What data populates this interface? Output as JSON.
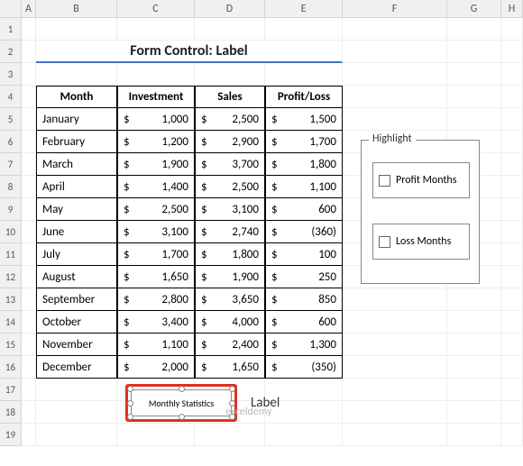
{
  "columns": [
    "A",
    "B",
    "C",
    "D",
    "E",
    "F",
    "G",
    "H"
  ],
  "title": "Form Control: Label",
  "table": {
    "headers": [
      "Month",
      "Investment",
      "Sales",
      "Profit/Loss"
    ],
    "rows": [
      {
        "month": "January",
        "inv": "1,000",
        "sales": "2,500",
        "pl": "1,500"
      },
      {
        "month": "February",
        "inv": "1,200",
        "sales": "2,900",
        "pl": "1,700"
      },
      {
        "month": "March",
        "inv": "1,900",
        "sales": "3,700",
        "pl": "1,800"
      },
      {
        "month": "April",
        "inv": "1,400",
        "sales": "2,500",
        "pl": "1,100"
      },
      {
        "month": "May",
        "inv": "2,500",
        "sales": "3,100",
        "pl": "600"
      },
      {
        "month": "June",
        "inv": "3,100",
        "sales": "2,740",
        "pl": "(360)"
      },
      {
        "month": "July",
        "inv": "1,700",
        "sales": "1,800",
        "pl": "100"
      },
      {
        "month": "August",
        "inv": "1,650",
        "sales": "1,900",
        "pl": "250"
      },
      {
        "month": "September",
        "inv": "2,800",
        "sales": "3,650",
        "pl": "850"
      },
      {
        "month": "October",
        "inv": "3,400",
        "sales": "4,000",
        "pl": "600"
      },
      {
        "month": "November",
        "inv": "1,100",
        "sales": "2,400",
        "pl": "1,300"
      },
      {
        "month": "December",
        "inv": "2,000",
        "sales": "1,650",
        "pl": "(350)"
      }
    ]
  },
  "currency_symbol": "$",
  "panel": {
    "title": "Highlight",
    "opt1": "Profit Months",
    "opt2": "Loss Months"
  },
  "label_control": {
    "text": "Monthly Statistics",
    "caption": "Label"
  },
  "watermark": "exceldemy"
}
